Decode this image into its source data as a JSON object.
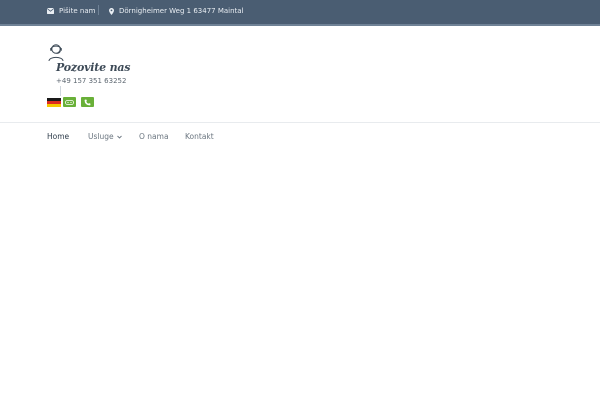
{
  "topbar": {
    "email_label": "Pišite nam",
    "email_icon": "envelope-icon",
    "address": "Dörnigheimer Weg 1 63477 Maintal",
    "address_icon": "map-pin-icon",
    "background": "#4a5d72"
  },
  "header": {
    "logo_icon": "support-person-icon",
    "call_title": "Pozovite nas",
    "phone": "+49 157 351 63252",
    "language_flag": "german-flag-icon",
    "whatsapp_icon": "whatsapp-icon",
    "call_icon": "phone-icon",
    "accent": "#69b038"
  },
  "nav": {
    "items": [
      {
        "label": "Home",
        "active": true
      },
      {
        "label": "Usluge",
        "has_dropdown": true
      },
      {
        "label": "O nama"
      },
      {
        "label": "Kontakt"
      }
    ]
  }
}
